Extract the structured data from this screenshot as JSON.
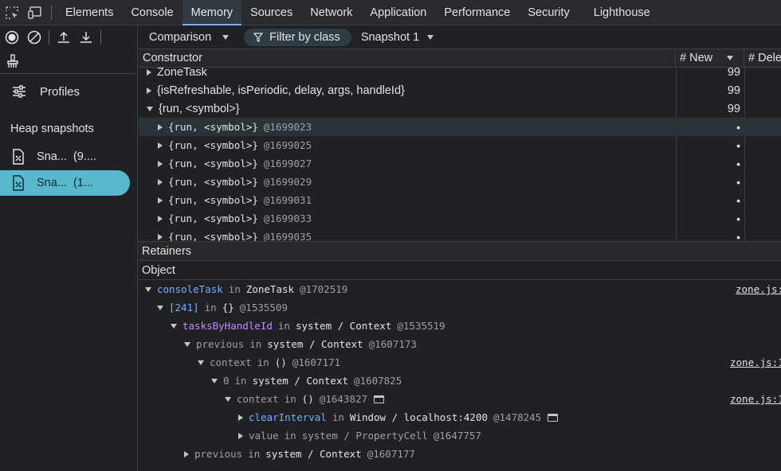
{
  "tabs": [
    "Elements",
    "Console",
    "Memory",
    "Sources",
    "Network",
    "Application",
    "Performance",
    "Security",
    "Lighthouse"
  ],
  "active_tab": "Memory",
  "sidebar": {
    "profiles_label": "Profiles",
    "heap_title": "Heap snapshots",
    "snapshots": [
      {
        "label": "Sna...",
        "size": "(9...."
      },
      {
        "label": "Sna...",
        "size": "(1..."
      }
    ]
  },
  "toolbar": {
    "view_label": "Comparison",
    "filter_label": "Filter by class",
    "snapshot_label": "Snapshot 1"
  },
  "grid": {
    "headers": [
      "Constructor",
      "# New",
      "# Dele"
    ],
    "rows": [
      {
        "name": "ZoneTask",
        "new": "99",
        "expand": "right"
      },
      {
        "name": "{isRefreshable, isPeriodic, delay, args, handleId}",
        "new": "99",
        "expand": "right"
      },
      {
        "name": "{run, <symbol>}",
        "new": "99",
        "expand": "down"
      },
      {
        "name": "{run, <symbol>}",
        "id": "@1699023",
        "new": "•",
        "expand": "right"
      },
      {
        "name": "{run, <symbol>}",
        "id": "@1699025",
        "new": "•",
        "expand": "right"
      },
      {
        "name": "{run, <symbol>}",
        "id": "@1699027",
        "new": "•",
        "expand": "right"
      },
      {
        "name": "{run, <symbol>}",
        "id": "@1699029",
        "new": "•",
        "expand": "right"
      },
      {
        "name": "{run, <symbol>}",
        "id": "@1699031",
        "new": "•",
        "expand": "right"
      },
      {
        "name": "{run, <symbol>}",
        "id": "@1699033",
        "new": "•",
        "expand": "right"
      },
      {
        "name": "{run, <symbol>}",
        "id": "@1699035",
        "new": "•",
        "expand": "right"
      }
    ]
  },
  "retainers": {
    "title": "Retainers",
    "header": "Object",
    "rows": [
      {
        "key": "consoleTask",
        "kc": "blue",
        "in": "in",
        "type": "ZoneTask",
        "id": "@1702519",
        "src": "zone.js:",
        "expand": "down"
      },
      {
        "key": "[241]",
        "kc": "blue",
        "in": "in",
        "type": "{}",
        "id": "@1535509",
        "src": "",
        "expand": "down"
      },
      {
        "key": "tasksByHandleId",
        "kc": "purple",
        "in": "in",
        "type": "system / Context",
        "id": "@1535519",
        "src": "",
        "expand": "down"
      },
      {
        "key": "previous",
        "kc": "grey",
        "in": "in",
        "type": "system / Context",
        "id": "@1607173",
        "src": "",
        "expand": "down"
      },
      {
        "key": "context",
        "kc": "grey",
        "in": "in",
        "type": "()",
        "id": "@1607171",
        "src": "zone.js:1",
        "expand": "down"
      },
      {
        "key": "0",
        "kc": "grey",
        "in": "in",
        "type": "system / Context",
        "id": "@1607825",
        "src": "",
        "expand": "down"
      },
      {
        "key": "context",
        "kc": "grey",
        "in": "in",
        "type": "()",
        "id": "@1643827",
        "src": "zone.js:1",
        "expand": "down",
        "win": true
      },
      {
        "key": "clearInterval",
        "kc": "blue",
        "in": "in",
        "type": "Window / localhost:4200",
        "id": "@1478245",
        "src": "",
        "expand": "right",
        "win": true
      },
      {
        "key": "value",
        "kc": "grey",
        "in": "in",
        "type": "system / PropertyCell",
        "id": "@1647757",
        "src": "",
        "expand": "right",
        "dimtype": true
      },
      {
        "key": "previous",
        "kc": "grey",
        "in": "in",
        "type": "system / Context",
        "id": "@1607177",
        "src": "",
        "expand": "right"
      }
    ]
  }
}
